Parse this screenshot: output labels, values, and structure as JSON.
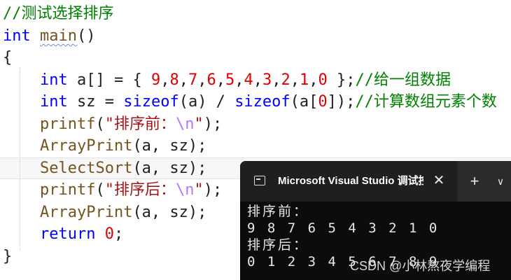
{
  "editor": {
    "lines": [
      [
        {
          "t": "//测试选择排序",
          "c": "comment"
        }
      ],
      [
        {
          "t": "int",
          "c": "kw"
        },
        {
          "t": " ",
          "c": "id"
        },
        {
          "t": "main",
          "c": "fn squiggle"
        },
        {
          "t": "()",
          "c": "id"
        }
      ],
      [
        {
          "t": "{",
          "c": "id"
        }
      ],
      [
        {
          "t": "    ",
          "c": "id"
        },
        {
          "t": "int",
          "c": "kw"
        },
        {
          "t": " a[] = { ",
          "c": "id"
        },
        {
          "t": "9",
          "c": "num"
        },
        {
          "t": ",",
          "c": "id"
        },
        {
          "t": "8",
          "c": "num"
        },
        {
          "t": ",",
          "c": "id"
        },
        {
          "t": "7",
          "c": "num"
        },
        {
          "t": ",",
          "c": "id"
        },
        {
          "t": "6",
          "c": "num"
        },
        {
          "t": ",",
          "c": "id"
        },
        {
          "t": "5",
          "c": "num"
        },
        {
          "t": ",",
          "c": "id"
        },
        {
          "t": "4",
          "c": "num"
        },
        {
          "t": ",",
          "c": "id"
        },
        {
          "t": "3",
          "c": "num"
        },
        {
          "t": ",",
          "c": "id"
        },
        {
          "t": "2",
          "c": "num"
        },
        {
          "t": ",",
          "c": "id"
        },
        {
          "t": "1",
          "c": "num"
        },
        {
          "t": ",",
          "c": "id"
        },
        {
          "t": "0",
          "c": "num"
        },
        {
          "t": " };",
          "c": "id"
        },
        {
          "t": "//给一组数据",
          "c": "comment"
        }
      ],
      [
        {
          "t": "    ",
          "c": "id"
        },
        {
          "t": "int",
          "c": "kw"
        },
        {
          "t": " sz = ",
          "c": "id"
        },
        {
          "t": "sizeof",
          "c": "kw"
        },
        {
          "t": "(a) / ",
          "c": "id"
        },
        {
          "t": "sizeof",
          "c": "kw"
        },
        {
          "t": "(a[",
          "c": "id"
        },
        {
          "t": "0",
          "c": "num"
        },
        {
          "t": "]);",
          "c": "id"
        },
        {
          "t": "//计算数组元素个数",
          "c": "comment"
        }
      ],
      [
        {
          "t": "    ",
          "c": "id"
        },
        {
          "t": "printf",
          "c": "fn"
        },
        {
          "t": "(",
          "c": "id"
        },
        {
          "t": "\"排序前：",
          "c": "str"
        },
        {
          "t": "\\n",
          "c": "esc"
        },
        {
          "t": "\"",
          "c": "str"
        },
        {
          "t": ");",
          "c": "id"
        }
      ],
      [
        {
          "t": "    ",
          "c": "id"
        },
        {
          "t": "ArrayPrint",
          "c": "fn"
        },
        {
          "t": "(a, sz);",
          "c": "id"
        }
      ],
      [
        {
          "t": "    ",
          "c": "id"
        },
        {
          "t": "SelectSort",
          "c": "fn"
        },
        {
          "t": "(a, sz);",
          "c": "id"
        }
      ],
      [
        {
          "t": "    ",
          "c": "id"
        },
        {
          "t": "printf",
          "c": "fn"
        },
        {
          "t": "(",
          "c": "id"
        },
        {
          "t": "\"排序后：",
          "c": "str"
        },
        {
          "t": "\\n",
          "c": "esc"
        },
        {
          "t": "\"",
          "c": "str"
        },
        {
          "t": ");",
          "c": "id"
        }
      ],
      [
        {
          "t": "    ",
          "c": "id"
        },
        {
          "t": "ArrayPrint",
          "c": "fn"
        },
        {
          "t": "(a, sz);",
          "c": "id"
        }
      ],
      [
        {
          "t": "    ",
          "c": "id"
        },
        {
          "t": "return",
          "c": "kw"
        },
        {
          "t": " ",
          "c": "id"
        },
        {
          "t": "0",
          "c": "num"
        },
        {
          "t": ";",
          "c": "id"
        }
      ],
      [
        {
          "t": "}",
          "c": "id"
        }
      ]
    ]
  },
  "console": {
    "tab_title": "Microsoft Visual Studio 调试控制台",
    "close_glyph": "✕",
    "new_tab_glyph": "+",
    "dropdown_glyph": "∨",
    "output_lines": [
      "排序前：",
      "9 8 7 6 5 4 3 2 1 0",
      "排序后：",
      "0 1 2 3 4 5 6 7 8 9"
    ]
  },
  "watermark": "CSDN @小林熬夜学编程",
  "colors": {
    "comment": "#008000",
    "keyword": "#0000ff",
    "function": "#74531f",
    "number": "#e00000",
    "string": "#a31515",
    "escape": "#b776fb",
    "console_bg": "#0c0c0c",
    "titlebar_bg": "#2b2b2b"
  }
}
